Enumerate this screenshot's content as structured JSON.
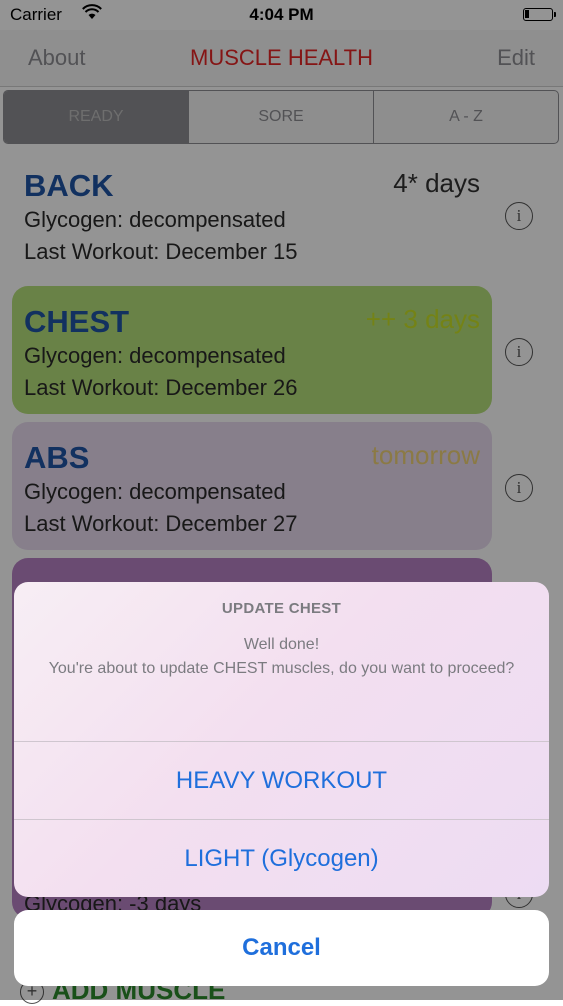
{
  "status_bar": {
    "carrier": "Carrier",
    "time": "4:04 PM"
  },
  "nav": {
    "left": "About",
    "title": "MUSCLE HEALTH",
    "right": "Edit"
  },
  "segments": [
    {
      "label": "READY",
      "selected": true
    },
    {
      "label": "SORE",
      "selected": false
    },
    {
      "label": "A - Z",
      "selected": false
    }
  ],
  "muscles": [
    {
      "name": "BACK",
      "days": "4* days",
      "glycogen": "Glycogen: decompensated",
      "last_workout": "Last Workout: December 15",
      "card_color": "#ffffff",
      "days_color": "#333333"
    },
    {
      "name": "CHEST",
      "days": "++ 3 days",
      "glycogen": "Glycogen: decompensated",
      "last_workout": "Last Workout: December 26",
      "card_color": "#b6e07a",
      "days_color": "#c9e227"
    },
    {
      "name": "ABS",
      "days": "tomorrow",
      "glycogen": "Glycogen: decompensated",
      "last_workout": "Last Workout: December 27",
      "card_color": "#e8dbf0",
      "days_color": "#f0d277"
    }
  ],
  "background_rows": [
    {
      "text": "Glycogen: -3 days"
    }
  ],
  "add_button": {
    "label": "ADD MUSCLE"
  },
  "action_sheet": {
    "title": "UPDATE CHEST",
    "message_line1": "Well done!",
    "message_line2": "You're about to update CHEST muscles, do you want to proceed?",
    "buttons": [
      "HEAVY WORKOUT",
      "LIGHT (Glycogen)"
    ],
    "cancel": "Cancel"
  },
  "colors": {
    "accent": "#1f6fdc",
    "title_red": "#e52525",
    "muscle_blue": "#1f55a6"
  }
}
